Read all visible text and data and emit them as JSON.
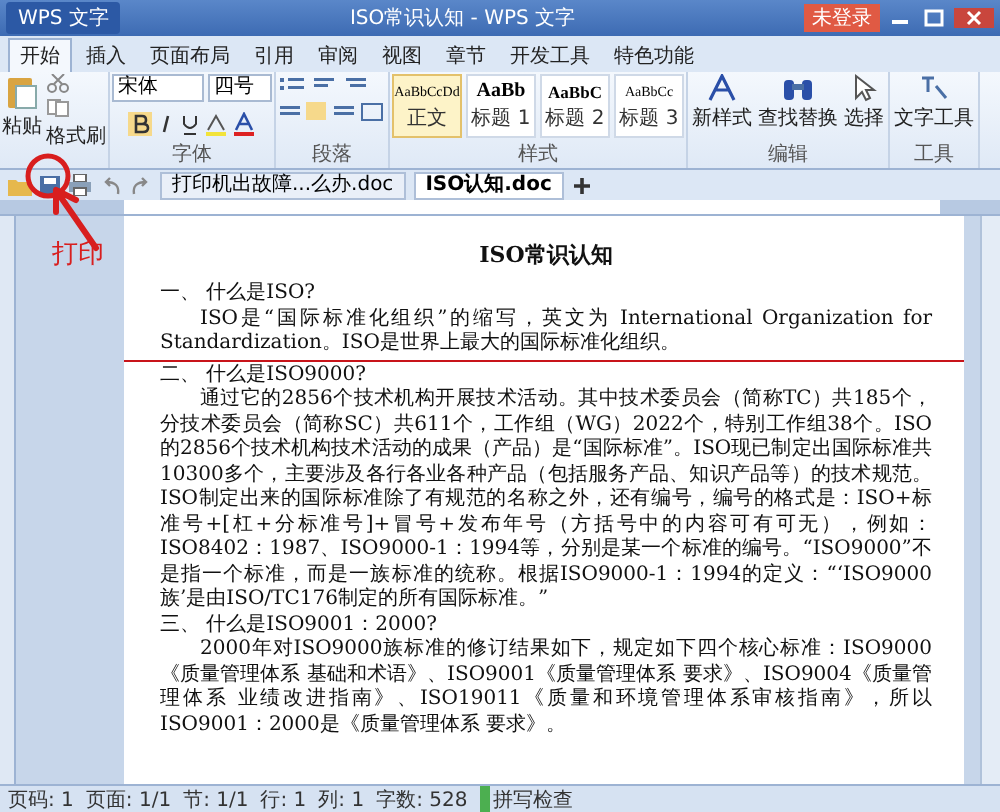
{
  "window": {
    "title": "ISO常识认知 - WPS 文字",
    "app_menu": "WPS 文字",
    "login": "未登录"
  },
  "ribbon_tabs": [
    {
      "label": "开始",
      "selected": true
    },
    {
      "label": "插入",
      "selected": false
    },
    {
      "label": "页面布局",
      "selected": false
    },
    {
      "label": "引用",
      "selected": false
    },
    {
      "label": "审阅",
      "selected": false
    },
    {
      "label": "视图",
      "selected": false
    },
    {
      "label": "章节",
      "selected": false
    },
    {
      "label": "开发工具",
      "selected": false
    },
    {
      "label": "特色功能",
      "selected": false
    }
  ],
  "ribbon": {
    "paste": "粘贴",
    "format_painter": "格式刷",
    "font_name": "宋体",
    "font_size": "四号",
    "font_label": "字体",
    "paragraph_label": "段落",
    "styles": [
      {
        "preview": "AaBbCcDd",
        "label": "正文",
        "selected": true
      },
      {
        "preview": "AaBb",
        "label": "标题 1",
        "selected": false
      },
      {
        "preview": "AaBbC",
        "label": "标题 2",
        "selected": false
      },
      {
        "preview": "AaBbCc",
        "label": "标题 3",
        "selected": false
      }
    ],
    "styles_label": "样式",
    "new_style": "新样式",
    "find_replace": "查找替换",
    "select": "选择",
    "edit_label": "编辑",
    "text_tools": "文字工具",
    "tools_label": "工具"
  },
  "doc_tabs": [
    {
      "label": "打印机出故障...么办.doc",
      "selected": false
    },
    {
      "label": "ISO认知.doc",
      "selected": true
    }
  ],
  "annotation": {
    "label": "打印"
  },
  "document": {
    "title": "ISO常识认知",
    "blocks": [
      {
        "kind": "heading",
        "text": "一、 什么是ISO?"
      },
      {
        "kind": "para",
        "text": "ISO是“国际标准化组织”的缩写，英文为 International Organization for Standardization。ISO是世界上最大的国际标准化组织。"
      },
      {
        "kind": "mark_line"
      },
      {
        "kind": "heading",
        "text": "二、 什么是ISO9000?"
      },
      {
        "kind": "para",
        "text": "通过它的2856个技术机构开展技术活动。其中技术委员会（简称TC）共185个，分技术委员会（简称SC）共611个，工作组（WG）2022个，特别工作组38个。ISO的2856个技术机构技术活动的成果（产品）是“国际标准”。ISO现已制定出国际标准共10300多个，主要涉及各行各业各种产品（包括服务产品、知识产品等）的技术规范。ISO制定出来的国际标准除了有规范的名称之外，还有编号，编号的格式是：ISO+标准号+[杠+分标准号]+冒号+发布年号（方括号中的内容可有可无），例如：ISO8402：1987、ISO9000-1：1994等，分别是某一个标准的编号。“ISO9000”不是指一个标准，而是一族标准的统称。根据ISO9000-1：1994的定义：“‘ISO9000族’是由ISO/TC176制定的所有国际标准。”"
      },
      {
        "kind": "heading",
        "text": "三、 什么是ISO9001：2000?"
      },
      {
        "kind": "para",
        "text": "2000年对ISO9000族标准的修订结果如下，规定如下四个核心标准：ISO9000《质量管理体系 基础和术语》、ISO9001《质量管理体系 要求》、ISO9004《质量管理体系 业绩改进指南》、ISO19011《质量和环境管理体系审核指南》，所以ISO9001：2000是《质量管理体系 要求》。"
      }
    ]
  },
  "status_bar": {
    "items": [
      "页码: 1",
      "页面: 1/1",
      "节: 1/1",
      "行: 1",
      "列: 1",
      "字数: 528"
    ],
    "spell_check": "拼写检查"
  }
}
